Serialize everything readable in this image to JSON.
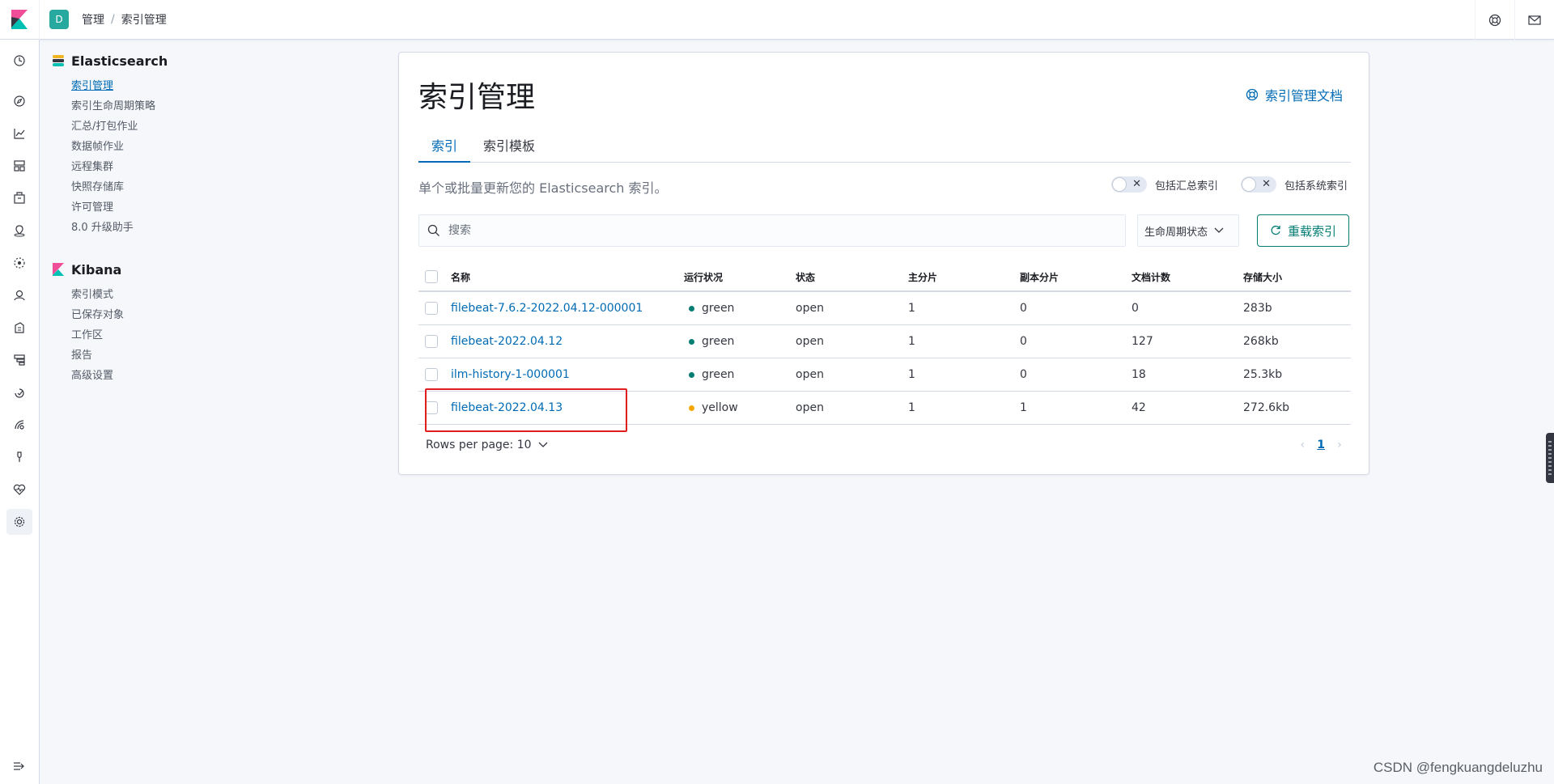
{
  "header": {
    "space_initial": "D",
    "breadcrumbs": [
      "管理",
      "索引管理"
    ]
  },
  "sidenav": {
    "groups": [
      {
        "title": "Elasticsearch",
        "items": [
          "索引管理",
          "索引生命周期策略",
          "汇总/打包作业",
          "数据帧作业",
          "远程集群",
          "快照存储库",
          "许可管理",
          "8.0 升级助手"
        ]
      },
      {
        "title": "Kibana",
        "items": [
          "索引模式",
          "已保存对象",
          "工作区",
          "报告",
          "高级设置"
        ]
      }
    ]
  },
  "main": {
    "title": "索引管理",
    "doc_link": "索引管理文档",
    "tabs": [
      {
        "label": "索引",
        "active": true
      },
      {
        "label": "索引模板",
        "active": false
      }
    ],
    "description": "单个或批量更新您的 Elasticsearch 索引。",
    "toggles": [
      {
        "label": "包括汇总索引",
        "on": false
      },
      {
        "label": "包括系统索引",
        "on": false
      }
    ],
    "search_placeholder": "搜索",
    "lifecycle_filter": "生命周期状态",
    "reload_button": "重载索引",
    "table": {
      "columns": [
        "名称",
        "运行状况",
        "状态",
        "主分片",
        "副本分片",
        "文档计数",
        "存储大小"
      ],
      "rows": [
        {
          "name": "filebeat-7.6.2-2022.04.12-000001",
          "health": "green",
          "status": "open",
          "primary": "1",
          "replicas": "0",
          "docs": "0",
          "size": "283b"
        },
        {
          "name": "filebeat-2022.04.12",
          "health": "green",
          "status": "open",
          "primary": "1",
          "replicas": "0",
          "docs": "127",
          "size": "268kb"
        },
        {
          "name": "ilm-history-1-000001",
          "health": "green",
          "status": "open",
          "primary": "1",
          "replicas": "0",
          "docs": "18",
          "size": "25.3kb"
        },
        {
          "name": "filebeat-2022.04.13",
          "health": "yellow",
          "status": "open",
          "primary": "1",
          "replicas": "1",
          "docs": "42",
          "size": "272.6kb"
        }
      ]
    },
    "rows_per_page": "Rows per page: 10",
    "current_page": "1"
  },
  "colors": {
    "green": "#017d73",
    "yellow": "#f5a700",
    "link": "#006bb4",
    "highlight": "#e01e1e"
  },
  "watermark": "CSDN @fengkuangdeluzhu"
}
